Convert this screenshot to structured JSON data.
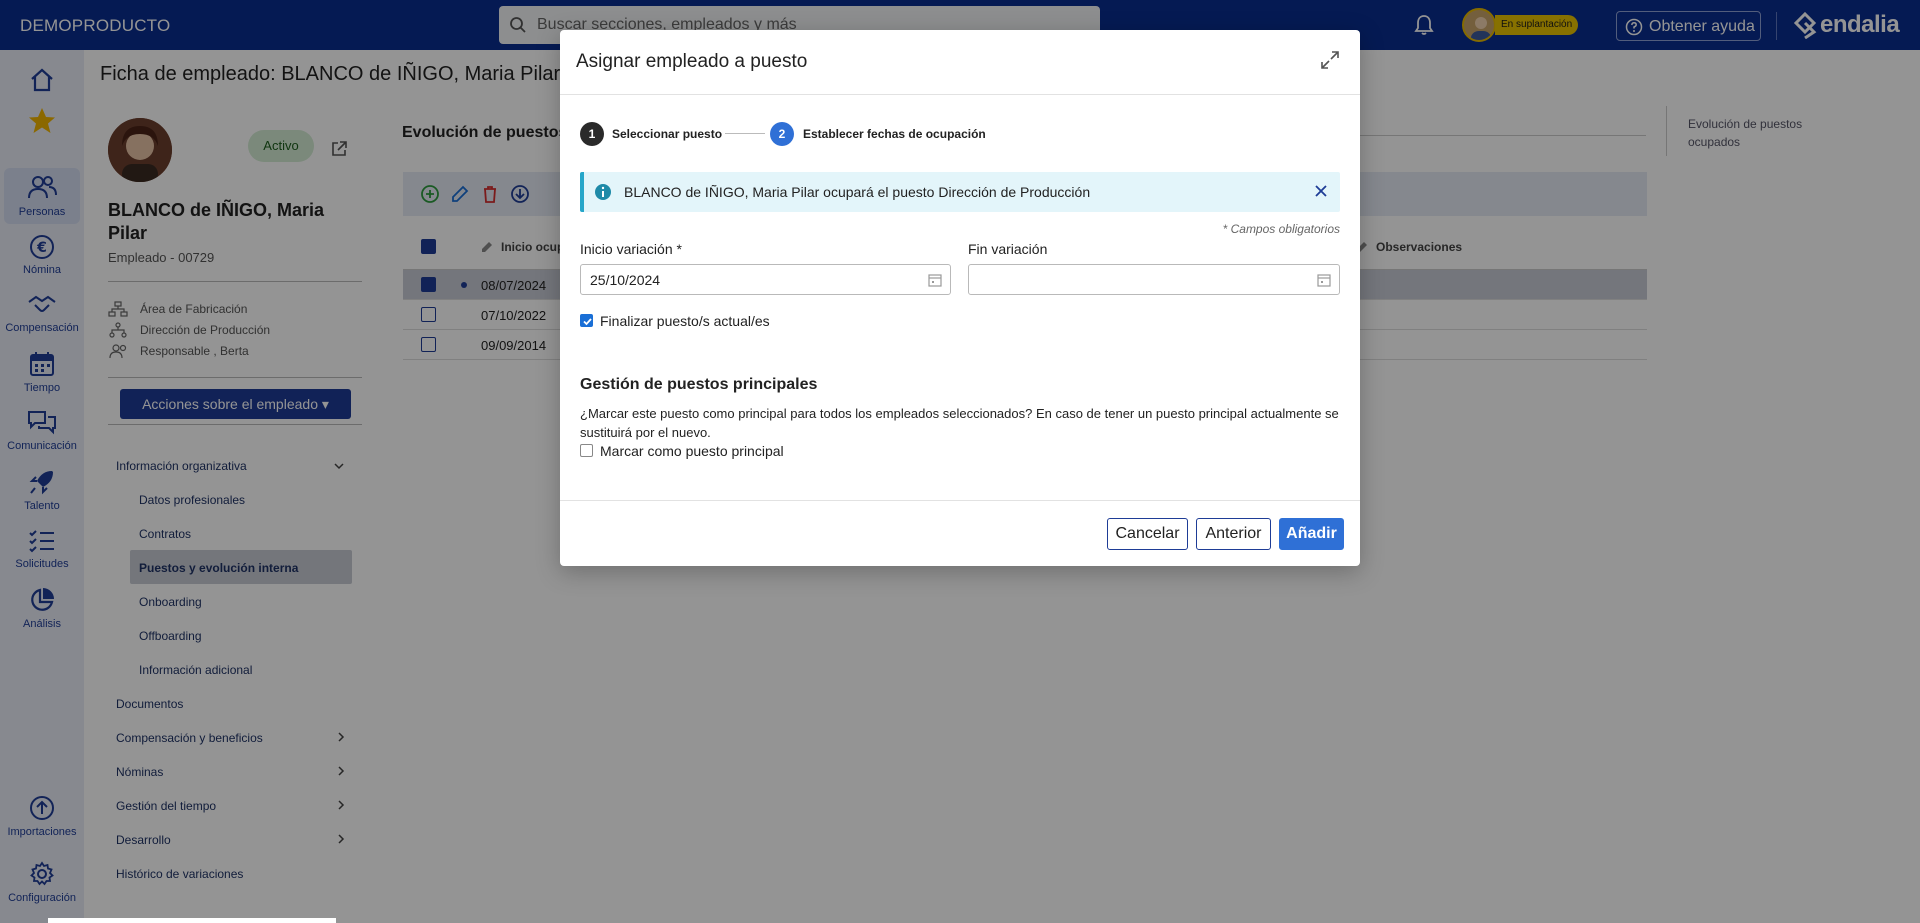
{
  "topbar": {
    "brand": "DEMOPRODUCTO",
    "search_placeholder": "Buscar secciones, empleados y más",
    "impersonation_badge": "En suplantación",
    "help_label": "Obtener ayuda",
    "logo_text": "endalia"
  },
  "rail": {
    "items": [
      {
        "label": ""
      },
      {
        "label": ""
      },
      {
        "label": "Personas"
      },
      {
        "label": "Nómina"
      },
      {
        "label": "Compensación"
      },
      {
        "label": "Tiempo"
      },
      {
        "label": "Comunicación"
      },
      {
        "label": "Talento"
      },
      {
        "label": "Solicitudes"
      },
      {
        "label": "Análisis"
      },
      {
        "label": "Importaciones"
      },
      {
        "label": "Configuración"
      }
    ]
  },
  "employee": {
    "page_title": "Ficha de empleado: BLANCO de IÑIGO, Maria Pilar",
    "status": "Activo",
    "name": "BLANCO de IÑIGO, Maria Pilar",
    "code": "Empleado - 00729",
    "area": "Área de Fabricación",
    "department": "Dirección de Producción",
    "manager": "Responsable , Berta",
    "actions_label": "Acciones sobre el empleado ▾"
  },
  "menu": {
    "org_info": "Información organizativa",
    "datos": "Datos profesionales",
    "contratos": "Contratos",
    "puestos": "Puestos y evolución interna",
    "onboarding": "Onboarding",
    "offboarding": "Offboarding",
    "adicional": "Información adicional",
    "documentos": "Documentos",
    "compensacion": "Compensación y beneficios",
    "nominas": "Nóminas",
    "tiempo": "Gestión del tiempo",
    "desarrollo": "Desarrollo",
    "historico": "Histórico de variaciones"
  },
  "main": {
    "section_title": "Evolución de puestos",
    "col_inicio": "Inicio ocup",
    "col_obs": "Observaciones",
    "rows": [
      {
        "date": "08/07/2024"
      },
      {
        "date": "07/10/2022"
      },
      {
        "date": "09/09/2014"
      }
    ],
    "right_panel": "Evolución de puestos ocupados"
  },
  "modal": {
    "title": "Asignar empleado a puesto",
    "step1_num": "1",
    "step1_label": "Seleccionar puesto",
    "step2_num": "2",
    "step2_label": "Establecer fechas de ocupación",
    "info_text": "BLANCO de IÑIGO, Maria Pilar ocupará el puesto Dirección de Producción",
    "required_note": "* Campos obligatorios",
    "start_label": "Inicio variación *",
    "start_value": "25/10/2024",
    "end_label": "Fin variación",
    "end_value": "",
    "finalize_label": "Finalizar puesto/s actual/es",
    "finalize_checked": true,
    "section_title": "Gestión de puestos principales",
    "section_desc": "¿Marcar este puesto como principal para todos los empleados seleccionados? En caso de tener un puesto principal actualmente se sustituirá por el nuevo.",
    "principal_label": "Marcar como puesto principal",
    "principal_checked": false,
    "cancel_label": "Cancelar",
    "prev_label": "Anterior",
    "add_label": "Añadir"
  },
  "colors": {
    "brand_blue": "#0a2d8f",
    "accent": "#2f70d6",
    "info_border": "#26a6c9"
  }
}
